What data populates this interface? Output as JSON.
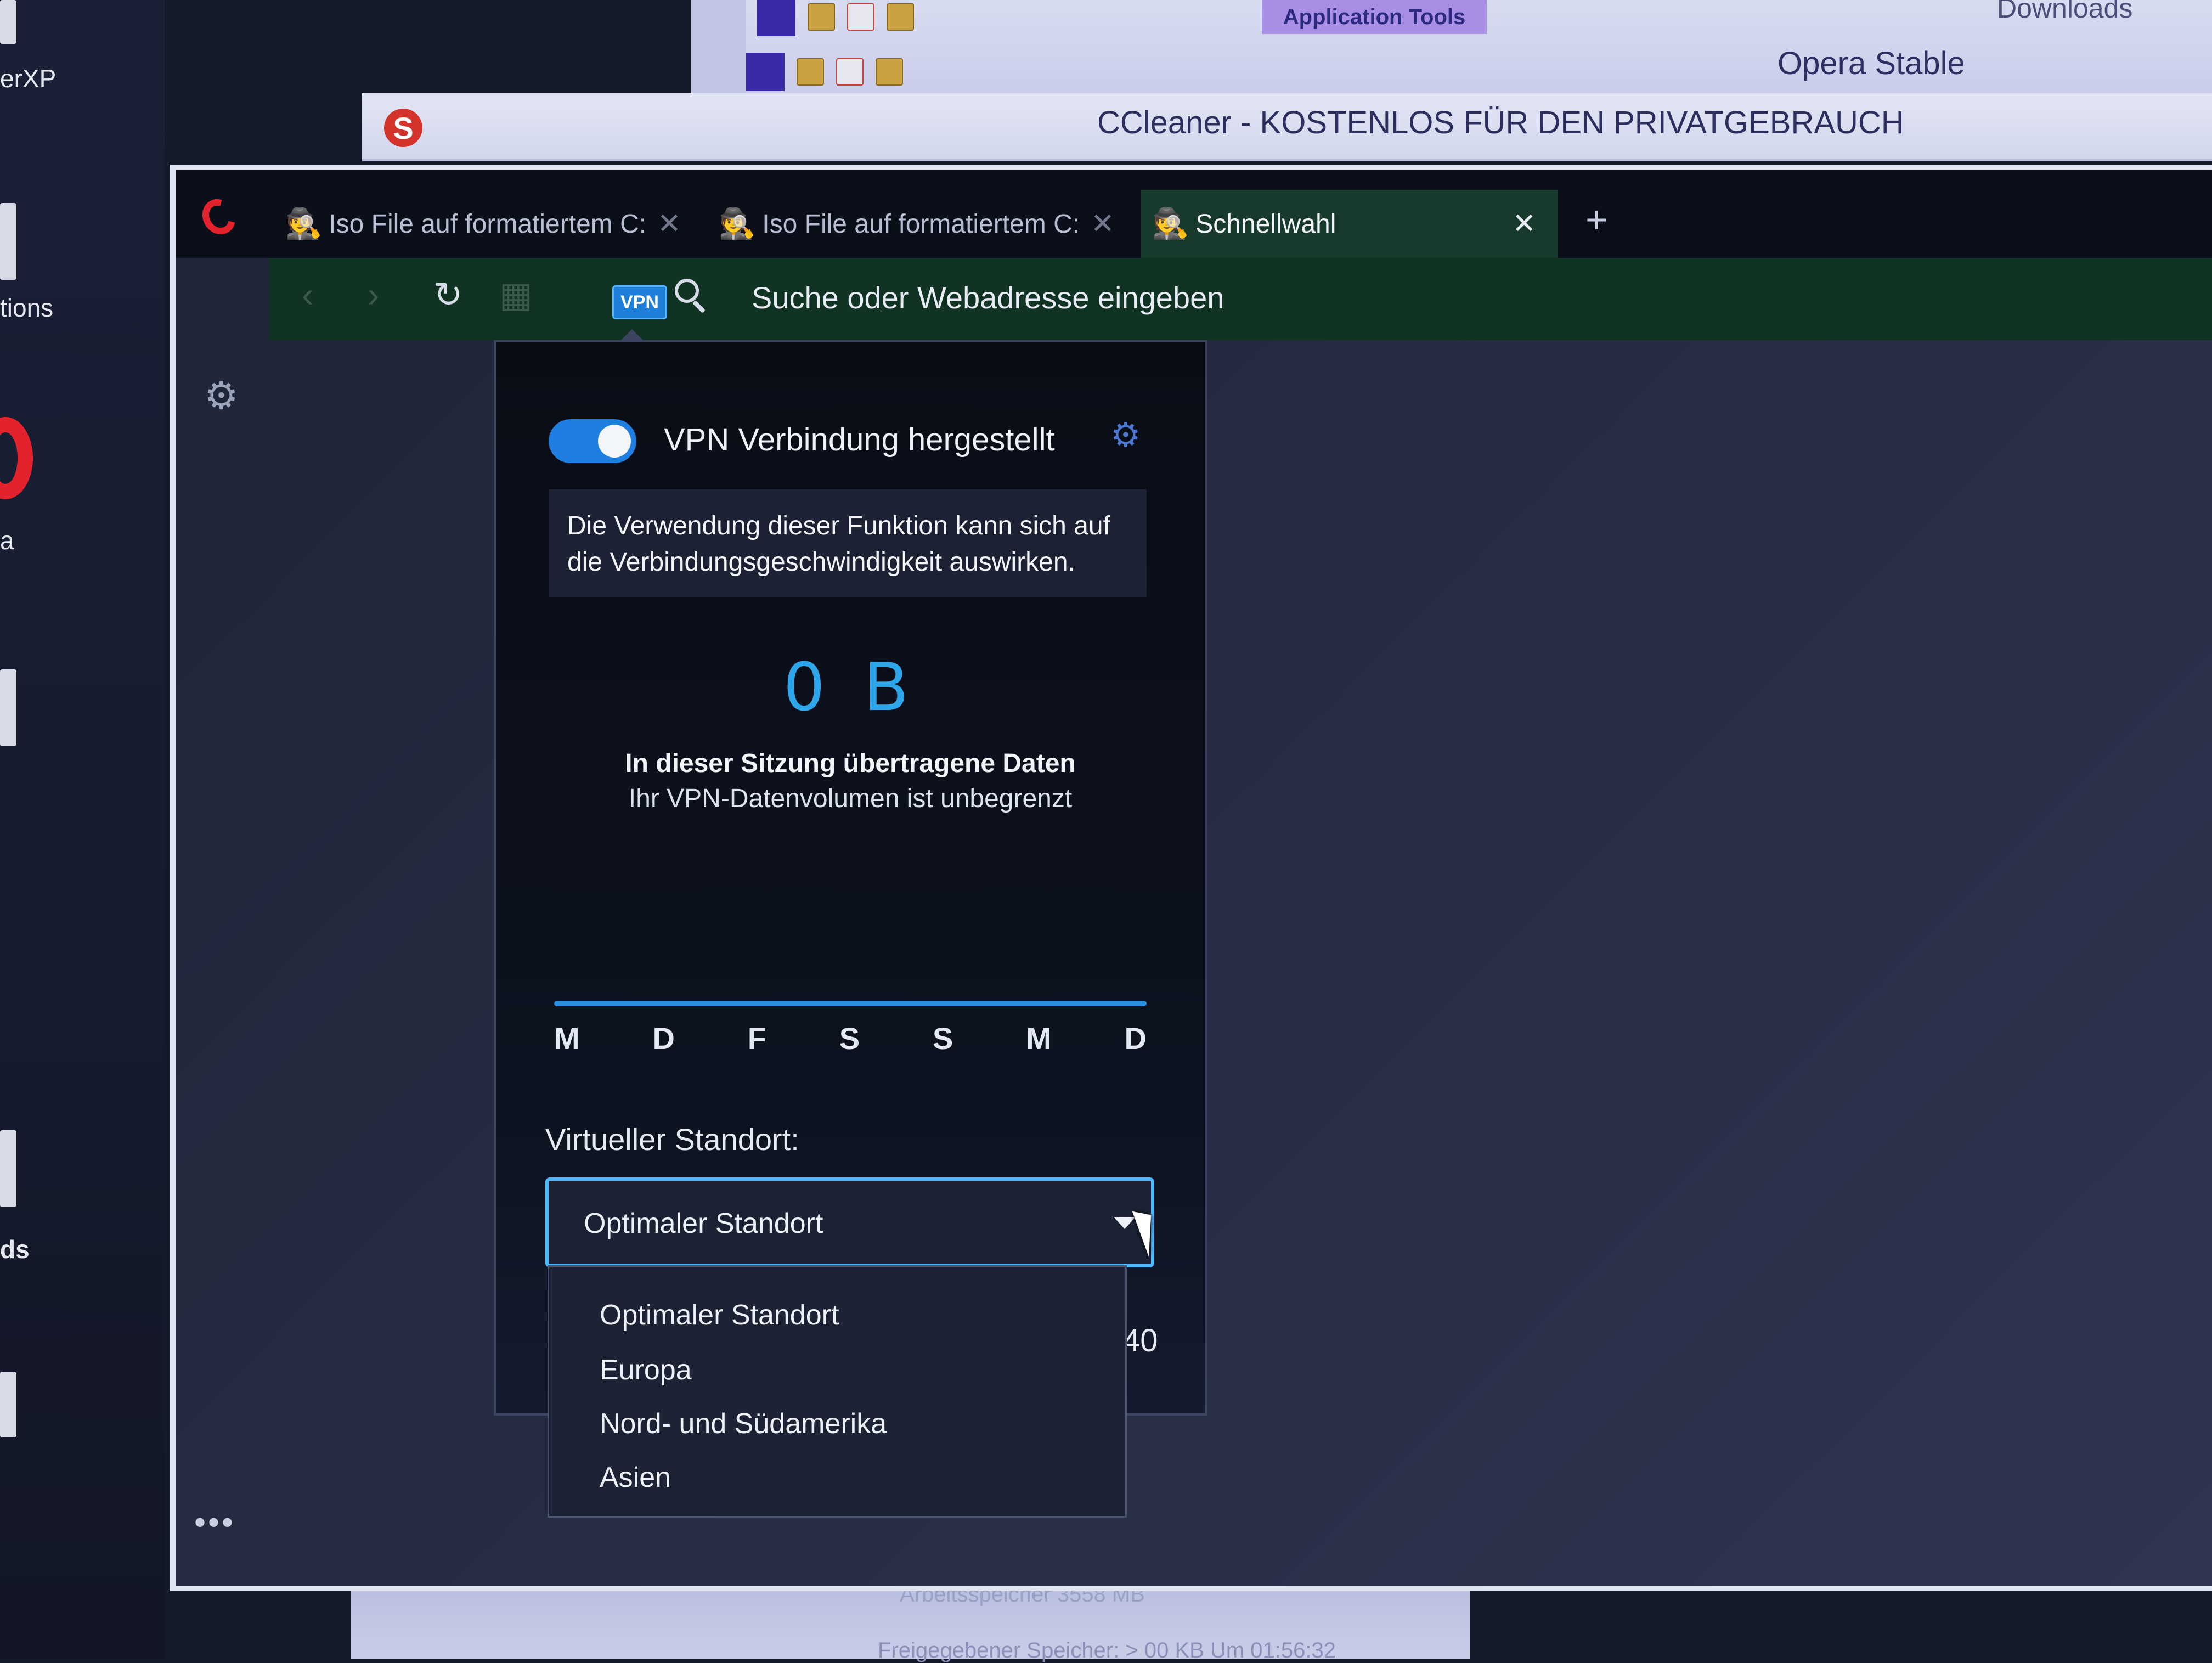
{
  "desktop": {
    "labels": [
      "erXP",
      "tions",
      "a",
      "ds"
    ]
  },
  "background_windows": {
    "application_tools": "Application Tools",
    "downloads": "Downloads",
    "opera_stable": "Opera Stable",
    "ccleaner_logo": "S",
    "ccleaner_title": "CCleaner - KOSTENLOS FÜR DEN PRIVATGEBRAUCH",
    "status_line_1": "Arbeitsspeicher 3558 MB",
    "status_line_2": "Freigegebener Speicher: > 00 KB Um 01:56:32"
  },
  "browser": {
    "tabs": [
      {
        "label": "Iso File auf formatiertem C:",
        "close": "✕"
      },
      {
        "label": "Iso File auf formatiertem C:",
        "close": "✕"
      },
      {
        "label": "Schnellwahl",
        "close": "✕"
      }
    ],
    "new_tab": "+",
    "toolbar": {
      "back": "‹",
      "forward": "›",
      "reload": "↻",
      "grid": "▦",
      "vpn_badge": "VPN",
      "address_placeholder": "Suche oder Webadresse eingeben"
    },
    "sidebar": {
      "settings_icon": "⚙",
      "more": "•••"
    }
  },
  "vpn_panel": {
    "status": "VPN Verbindung hergestellt",
    "settings_icon": "⚙",
    "info": "Die Verwendung dieser Funktion kann sich auf die Verbindungsgeschwindigkeit auswirken.",
    "data_amount": "0 B",
    "data_label": "In dieser Sitzung übertragene Daten",
    "data_sub": "Ihr VPN-Datenvolumen ist unbegrenzt",
    "days": [
      "M",
      "D",
      "F",
      "S",
      "S",
      "M",
      "D"
    ],
    "location_label": "Virtueller Standort:",
    "location_selected": "Optimaler Standort",
    "location_options": [
      "Optimaler Standort",
      "Europa",
      "Nord- und Südamerika",
      "Asien"
    ],
    "side_number": "40"
  },
  "colors": {
    "accent_blue": "#2ea6ea",
    "toggle_on": "#1f7fe0",
    "toolbar_green": "#113324",
    "opera_red": "#e4222d"
  }
}
